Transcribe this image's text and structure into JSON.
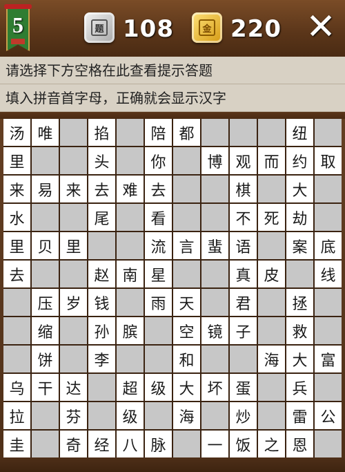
{
  "header": {
    "level": "5",
    "silver_icon": "题",
    "silver_count": "108",
    "gold_icon": "金",
    "gold_count": "220",
    "close_label": "✕"
  },
  "hints": {
    "line1": "请选择下方空格在此查看提示答题",
    "line2": "填入拼音首字母，正确就会显示汉字"
  },
  "grid": [
    [
      "汤",
      "唯",
      "",
      "掐",
      "",
      "陪",
      "都",
      "",
      "",
      "",
      "纽",
      ""
    ],
    [
      "里",
      "",
      "",
      "头",
      "",
      "你",
      "",
      "博",
      "观",
      "而",
      "约",
      "取"
    ],
    [
      "来",
      "易",
      "来",
      "去",
      "难",
      "去",
      "",
      "",
      "棋",
      "",
      "大",
      ""
    ],
    [
      "水",
      "",
      "",
      "尾",
      "",
      "看",
      "",
      "",
      "不",
      "死",
      "劫",
      ""
    ],
    [
      "里",
      "贝",
      "里",
      "",
      "",
      "流",
      "言",
      "蜚",
      "语",
      "",
      "案",
      "底"
    ],
    [
      "去",
      "",
      "",
      "赵",
      "南",
      "星",
      "",
      "",
      "真",
      "皮",
      "",
      "线"
    ],
    [
      "",
      "压",
      "岁",
      "钱",
      "",
      "雨",
      "天",
      "",
      "君",
      "",
      "拯",
      ""
    ],
    [
      "",
      "缩",
      "",
      "孙",
      "膑",
      "",
      "空",
      "镜",
      "子",
      "",
      "救",
      ""
    ],
    [
      "",
      "饼",
      "",
      "李",
      "",
      "",
      "和",
      "",
      "",
      "海",
      "大",
      "富"
    ],
    [
      "乌",
      "干",
      "达",
      "",
      "超",
      "级",
      "大",
      "坏",
      "蛋",
      "",
      "兵",
      ""
    ],
    [
      "拉",
      "",
      "芬",
      "",
      "级",
      "",
      "海",
      "",
      "炒",
      "",
      "雷",
      "公"
    ],
    [
      "圭",
      "",
      "奇",
      "经",
      "八",
      "脉",
      "",
      "一",
      "饭",
      "之",
      "恩",
      ""
    ]
  ]
}
